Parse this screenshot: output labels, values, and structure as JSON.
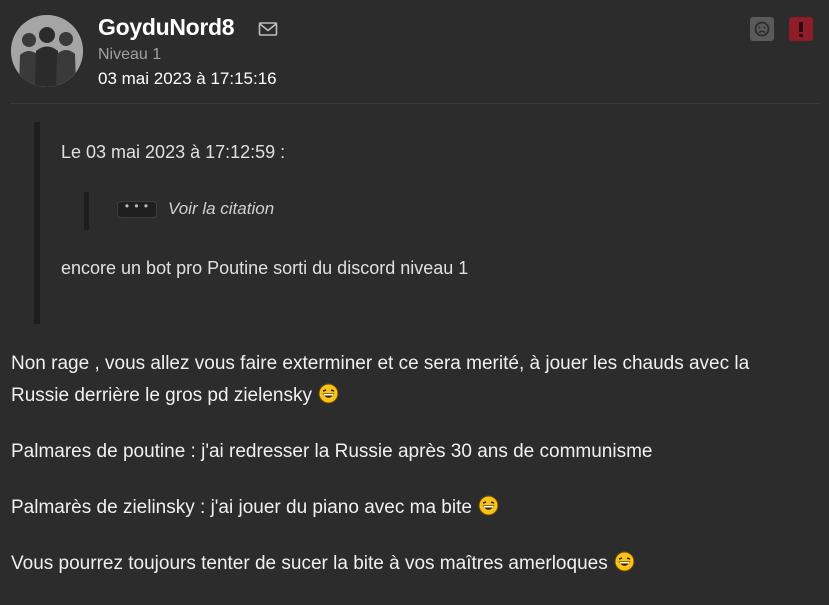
{
  "author": {
    "username": "GoyduNord8",
    "level": "Niveau 1",
    "date": "03 mai 2023 à 17:15:16"
  },
  "icons": {
    "mail": "mail-icon",
    "sad": "sad-face-icon",
    "alert": "exclamation-icon",
    "smiley": "laughing-smiley-icon"
  },
  "colors": {
    "background": "#2c2c2c",
    "alert_button": "#8e1d28",
    "sad_button": "#5a5a5a"
  },
  "quote": {
    "header": "Le 03 mai 2023 à 17:12:59 :",
    "nested_toggle": "• • •",
    "nested_label": "Voir la citation",
    "text": "encore un bot pro Poutine sorti du discord niveau 1"
  },
  "message": {
    "paragraphs": [
      "Non rage , vous allez vous faire exterminer et ce sera merité, à jouer les chauds avec la Russie derrière le gros pd zielensky",
      "Palmares de poutine : j'ai redresser la Russie après 30 ans de communisme",
      "Palmarès de zielinsky : j'ai jouer du piano avec ma bite",
      "Vous pourrez toujours tenter de sucer la bite à vos maîtres amerloques"
    ]
  }
}
